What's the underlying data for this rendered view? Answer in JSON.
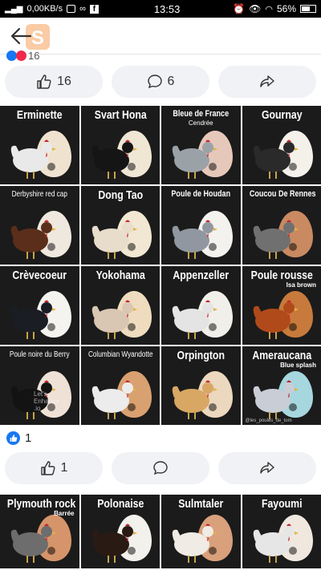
{
  "status_bar": {
    "network_speed": "0,00KB/s",
    "time": "13:53",
    "battery": "56%",
    "facebook_glyph": "f"
  },
  "post1": {
    "reaction_count": "16",
    "likes": "16",
    "comments": "6"
  },
  "grid1": [
    {
      "title": "Erminette",
      "subtitle": "",
      "egg_color": "#efe3d0",
      "hen_color": "#e9e9e9"
    },
    {
      "title": "Svart Hona",
      "subtitle": "",
      "egg_color": "#efe6d4",
      "hen_color": "#151515"
    },
    {
      "title": "Bleue de France",
      "subtitle": "Cendrée",
      "egg_color": "#e6c8bb",
      "hen_color": "#9aa2a8"
    },
    {
      "title": "Gournay",
      "subtitle": "",
      "egg_color": "#f4f1ea",
      "hen_color": "#2a2a2a"
    },
    {
      "title": "Derbyshire red cap",
      "subtitle": "",
      "egg_color": "#efe8de",
      "hen_color": "#5a2e1a"
    },
    {
      "title": "Dong Tao",
      "subtitle": "",
      "egg_color": "#f1e7d2",
      "hen_color": "#e8dccb"
    },
    {
      "title": "Poule de Houdan",
      "subtitle": "",
      "egg_color": "#f4f2ee",
      "hen_color": "#9097a0"
    },
    {
      "title": "Coucou De Rennes",
      "subtitle": "",
      "egg_color": "#c98a62",
      "hen_color": "#707070"
    },
    {
      "title": "Crèvecoeur",
      "subtitle": "",
      "egg_color": "#f4f3ef",
      "hen_color": "#1a1d24"
    },
    {
      "title": "Yokohama",
      "subtitle": "",
      "egg_color": "#efdcbf",
      "hen_color": "#d9c6b3"
    },
    {
      "title": "Appenzeller",
      "subtitle": "",
      "egg_color": "#f1efe9",
      "hen_color": "#e4e4e4"
    },
    {
      "title": "Poule rousse",
      "subtitle": "Isa brown",
      "egg_color": "#c77a3c",
      "hen_color": "#b14a1a"
    },
    {
      "title": "Poule noire du Berry",
      "subtitle": "",
      "egg_color": "#efe1d6",
      "hen_color": "#131313"
    },
    {
      "title": "Columbian Wyandotte",
      "subtitle": "",
      "egg_color": "#d9a070",
      "hen_color": "#ececec"
    },
    {
      "title": "Orpington",
      "subtitle": "",
      "egg_color": "#ecd7bf",
      "hen_color": "#d8a764"
    },
    {
      "title": "Ameraucana",
      "subtitle": "Blue splash",
      "egg_color": "#a6d7df",
      "hen_color": "#c9cdd6"
    }
  ],
  "watermark_text": "Let's Enhance .io",
  "handle_text": "@les_poules_de_tom",
  "post2": {
    "reaction_count": "1",
    "likes": "1"
  },
  "grid2": [
    {
      "title": "Plymouth rock",
      "subtitle": "Barrée",
      "egg_color": "#d6946a",
      "hen_color": "#6d6d6d"
    },
    {
      "title": "Polonaise",
      "subtitle": "",
      "egg_color": "#f3f1ec",
      "hen_color": "#2a1a14"
    },
    {
      "title": "Sulmtaler",
      "subtitle": "",
      "egg_color": "#d9a07c",
      "hen_color": "#f0ebe4"
    },
    {
      "title": "Fayoumi",
      "subtitle": "",
      "egg_color": "#f0e8df",
      "hen_color": "#e6e6e6"
    }
  ]
}
